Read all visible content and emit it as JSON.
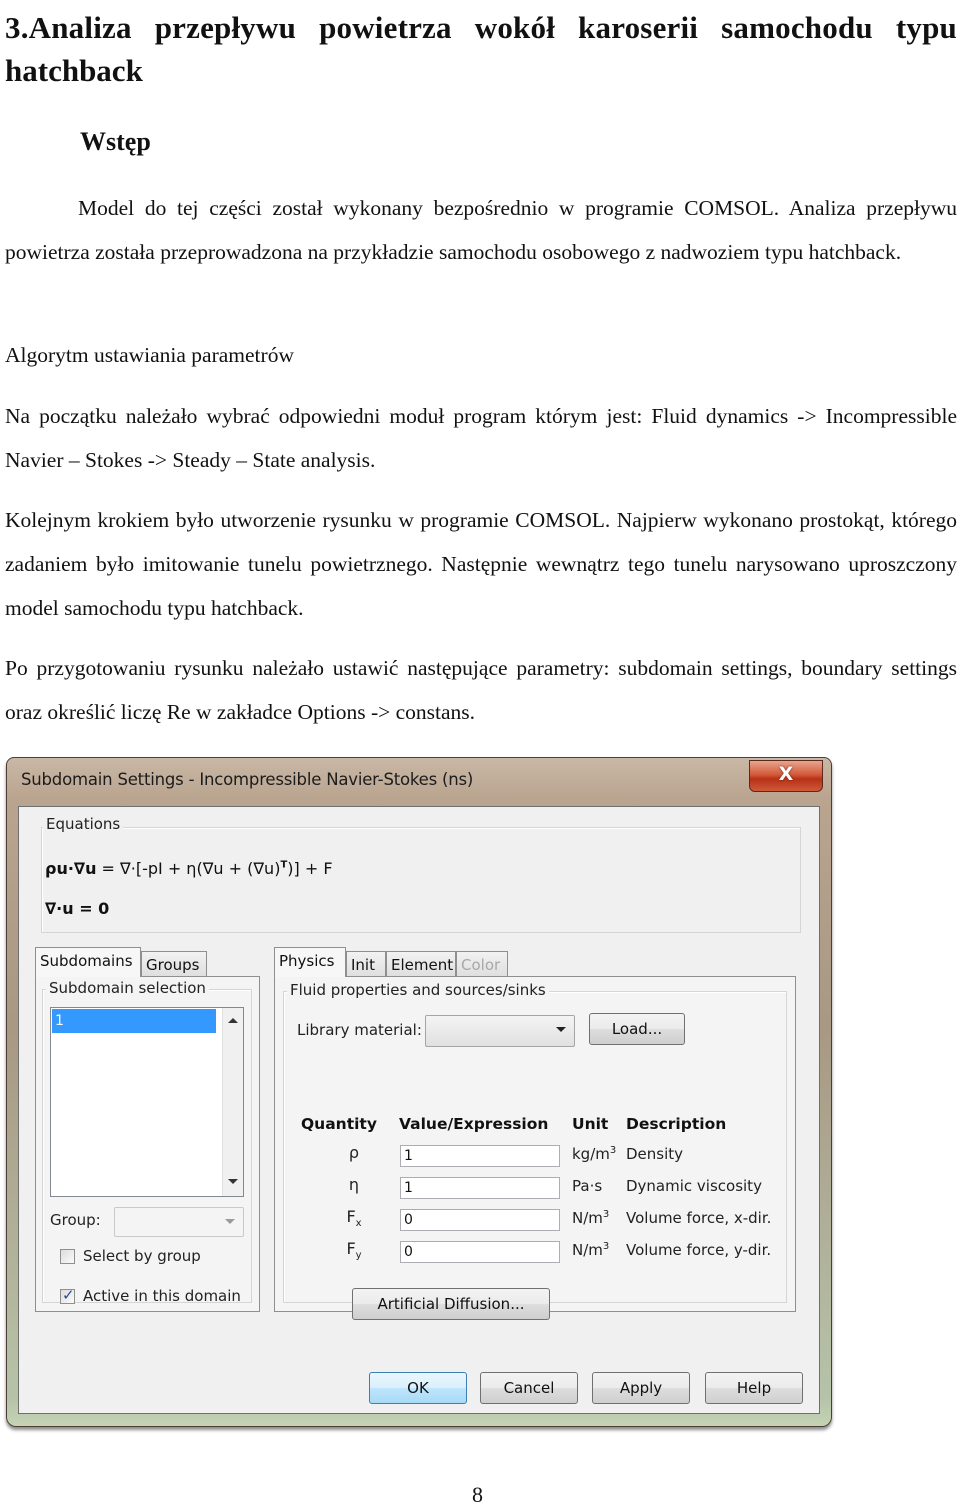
{
  "document": {
    "heading": "3.Analiza przepływu powietrza wokół karoserii samochodu typu",
    "heading_cont": "hatchback",
    "subheading": "Wstęp",
    "paragraphs": [
      "Model do tej części został wykonany bezpośrednio w programie COMSOL. Analiza przepływu powietrza została przeprowadzona na przykładzie samochodu osobowego z nadwoziem typu hatchback.",
      "Algorytm ustawiania parametrów",
      "Na początku należało wybrać odpowiedni moduł program którym jest: Fluid dynamics -> Incompressible Navier – Stokes -> Steady – State analysis.",
      "Kolejnym krokiem było utworzenie rysunku w programie COMSOL. Najpierw wykonano prostokąt, którego zadaniem było imitowanie tunelu powietrznego. Następnie wewnątrz tego tunelu narysowano uproszczony model samochodu typu hatchback.",
      "Po przygotowaniu rysunku należało ustawić następujące parametry: subdomain settings, boundary settings oraz określić liczę Re w zakładce Options -> constans."
    ],
    "page_number": "8"
  },
  "dialog": {
    "title": "Subdomain Settings - Incompressible Navier-Stokes (ns)",
    "close_icon": "close-x-icon",
    "close_label": "X",
    "equations": {
      "label": "Equations",
      "eq1_lhs": "ρu·∇u",
      "eq1_rhs": " = ∇·[-pI + η(∇u + (∇u)",
      "eq1_sup": "T",
      "eq1_tail": ")] + F",
      "eq2": "∇·u = 0"
    },
    "left_tabs": [
      {
        "label": "Subdomains",
        "active": true
      },
      {
        "label": "Groups",
        "active": false
      }
    ],
    "subdomain_selection": {
      "label": "Subdomain selection",
      "items": [
        "1"
      ],
      "selected": "1"
    },
    "group": {
      "label": "Group:",
      "value": ""
    },
    "select_by_group": {
      "label": "Select by group",
      "checked": false
    },
    "active_in_domain": {
      "label": "Active in this domain",
      "checked": true
    },
    "right_tabs": [
      {
        "label": "Physics",
        "active": true,
        "enabled": true
      },
      {
        "label": "Init",
        "active": false,
        "enabled": true
      },
      {
        "label": "Element",
        "active": false,
        "enabled": true
      },
      {
        "label": "Color",
        "active": false,
        "enabled": false
      }
    ],
    "physics": {
      "group_label": "Fluid properties and sources/sinks",
      "library_material_label": "Library material:",
      "library_material_value": "",
      "load_button": "Load...",
      "columns": [
        "Quantity",
        "Value/Expression",
        "Unit",
        "Description"
      ],
      "rows": [
        {
          "quantity": "ρ",
          "sub": "",
          "value": "1",
          "unit": "kg/m",
          "unit_sup": "3",
          "description": "Density"
        },
        {
          "quantity": "η",
          "sub": "",
          "value": "1",
          "unit": "Pa·s",
          "unit_sup": "",
          "description": "Dynamic viscosity"
        },
        {
          "quantity": "F",
          "sub": "x",
          "value": "0",
          "unit": "N/m",
          "unit_sup": "3",
          "description": "Volume force, x-dir."
        },
        {
          "quantity": "F",
          "sub": "y",
          "value": "0",
          "unit": "N/m",
          "unit_sup": "3",
          "description": "Volume force, y-dir."
        }
      ],
      "artificial_diffusion_button": "Artificial Diffusion..."
    },
    "buttons": {
      "ok": "OK",
      "cancel": "Cancel",
      "apply": "Apply",
      "help": "Help"
    }
  }
}
